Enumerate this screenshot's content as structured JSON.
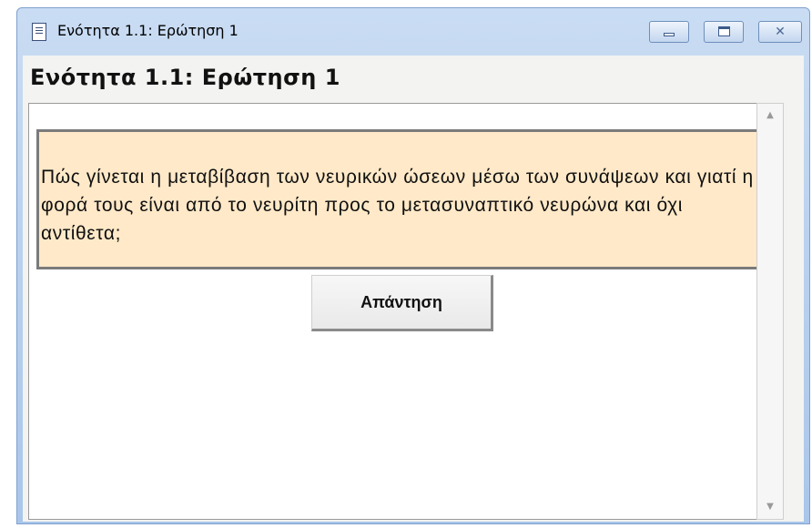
{
  "window": {
    "title": "Ενότητα 1.1: Ερώτηση 1",
    "icon": "document-icon",
    "controls": {
      "minimize_icon": "minimize-icon",
      "maximize_icon": "maximize-icon",
      "close_icon": "close-icon",
      "close_glyph": "✕"
    }
  },
  "page": {
    "heading": "Ενότητα 1.1: Ερώτηση 1"
  },
  "question": {
    "text": "Πώς γίνεται η μεταβίβαση των νευρικών ώσεων μέσω των συνάψεων και γιατί η φορά τους είναι από το νευρίτη προς το μετασυναπτικό νευρώνα και όχι αντίθετα;",
    "background_color": "#ffe9c8"
  },
  "answer_button": {
    "label": "Απάντηση"
  },
  "scrollbar": {
    "up_glyph": "▲",
    "down_glyph": "▼"
  },
  "colors": {
    "titlebar": "#c9dcf3",
    "client": "#f3f3f1"
  }
}
